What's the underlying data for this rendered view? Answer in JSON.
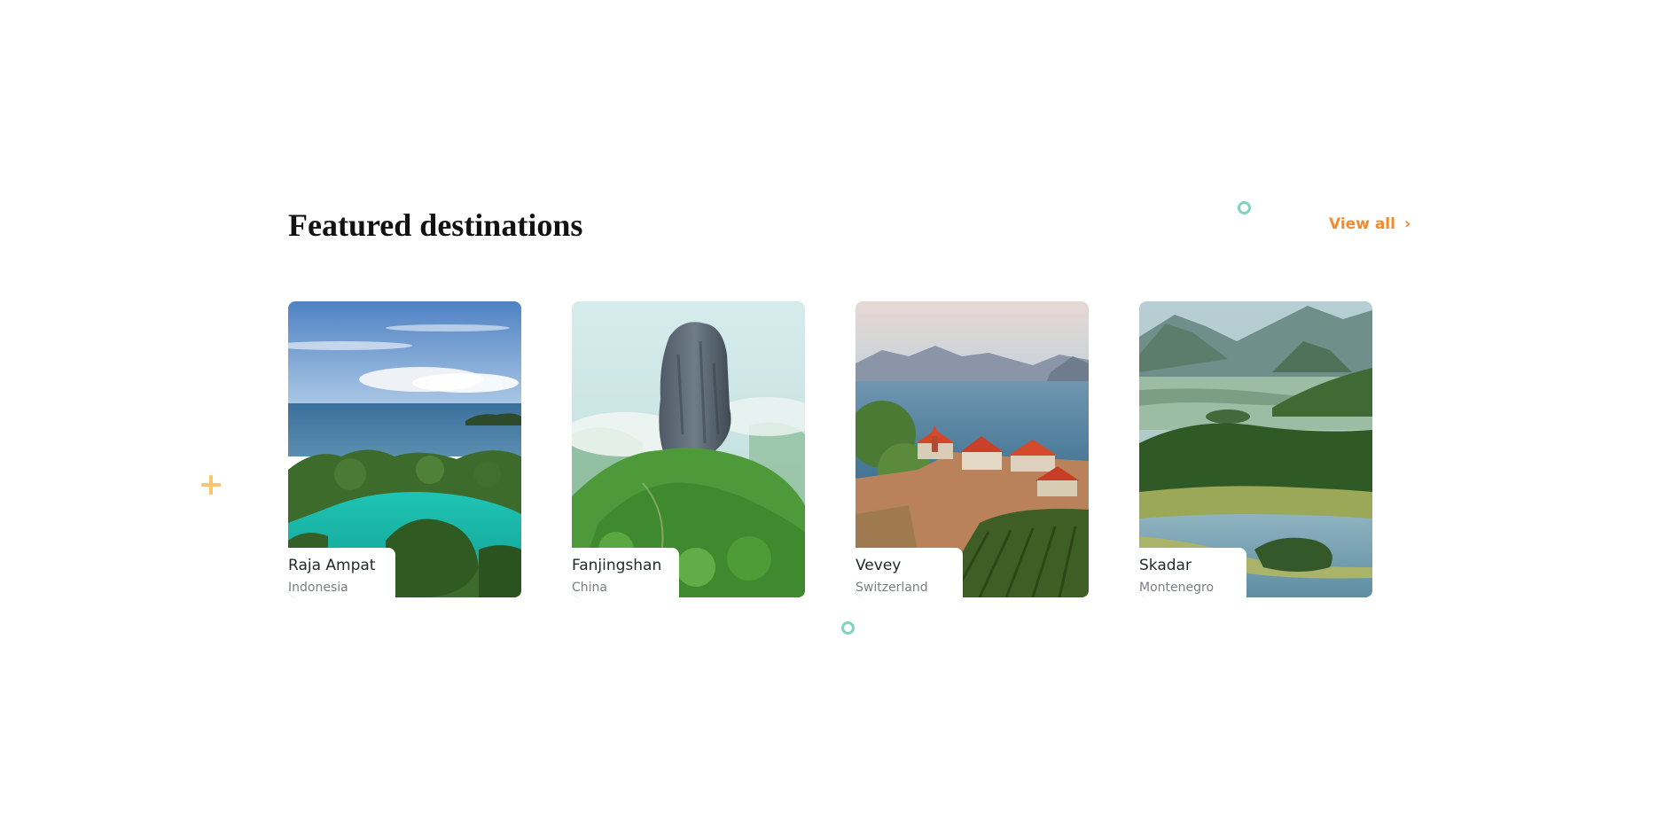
{
  "section": {
    "title": "Featured destinations",
    "view_all_label": "View all",
    "view_all_icon": "chevron-right-icon"
  },
  "colors": {
    "accent": "#f28a2e",
    "deco_circle": "#7fd3c0",
    "deco_plus": "#fbc56e",
    "title": "#111111",
    "name": "#1e2a2a",
    "country": "#7a7f85"
  },
  "destinations": [
    {
      "name": "Raja Ampat",
      "country": "Indonesia"
    },
    {
      "name": "Fanjingshan",
      "country": "China"
    },
    {
      "name": "Vevey",
      "country": "Switzerland"
    },
    {
      "name": "Skadar",
      "country": "Montenegro"
    }
  ]
}
